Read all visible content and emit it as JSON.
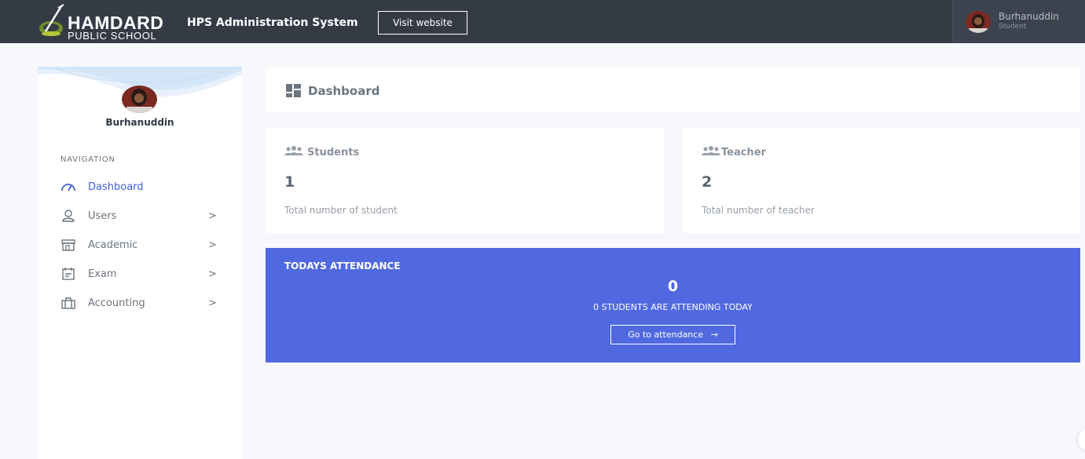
{
  "header": {
    "logo_line1": "HAMDARD",
    "logo_line2": "PUBLIC SCHOOL",
    "app_title": "HPS Administration System",
    "visit_button": "Visit website",
    "user_name": "Burhanuddin",
    "user_role": "Student"
  },
  "sidebar": {
    "profile_name": "Burhanuddin",
    "nav_title": "NAVIGATION",
    "items": [
      {
        "label": "Dashboard",
        "icon": "speedometer-icon",
        "active": true,
        "has_submenu": false
      },
      {
        "label": "Users",
        "icon": "user-icon",
        "active": false,
        "has_submenu": true,
        "chevron": ">"
      },
      {
        "label": "Academic",
        "icon": "store-icon",
        "active": false,
        "has_submenu": true,
        "chevron": ">"
      },
      {
        "label": "Exam",
        "icon": "calendar-icon",
        "active": false,
        "has_submenu": true,
        "chevron": ">"
      },
      {
        "label": "Accounting",
        "icon": "briefcase-icon",
        "active": false,
        "has_submenu": true,
        "chevron": ">"
      }
    ]
  },
  "page": {
    "title": "Dashboard",
    "title_icon": "dashboard-icon"
  },
  "stats": {
    "students": {
      "label": "Students",
      "value": "1",
      "description": "Total number of student",
      "icon": "group-icon"
    },
    "teacher": {
      "label": "Teacher",
      "value": "2",
      "description": "Total number of teacher",
      "icon": "group-icon"
    }
  },
  "attendance": {
    "title": "TODAYS ATTENDANCE",
    "count": "0",
    "subtitle": "0 STUDENTS ARE ATTENDING TODAY",
    "button_label": "Go to attendance",
    "button_arrow": "→"
  },
  "colors": {
    "topbar": "#343b45",
    "accent": "#3e60d5",
    "attendance_bg": "#5069e0",
    "page_bg": "#f7f8fc"
  }
}
